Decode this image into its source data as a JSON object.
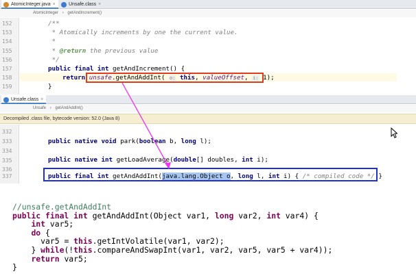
{
  "top_pane": {
    "tabs": [
      {
        "label": "AtomicInteger.java",
        "icon": "java-class-icon",
        "color": "#d08a2a"
      },
      {
        "label": "Unsafe.class",
        "icon": "class-file-icon",
        "color": "#3b7bd0"
      }
    ],
    "breadcrumb": [
      "AtomicInteger",
      "getAndIncrement()"
    ],
    "line_numbers": [
      "152",
      "153",
      "154",
      "155",
      "156",
      "157",
      "158",
      "159"
    ],
    "lines": {
      "l152": "/**",
      "l153": " * Atomically increments by one the current value.",
      "l154": " *",
      "l155_tag": "@return",
      "l155_rest": " the previous value",
      "l156": " */",
      "l157_kw": "public final int",
      "l157_rest": " getAndIncrement() {",
      "l158_kw": "return",
      "l158_field": "unsafe",
      "l158_mid": ".getAndAddInt(",
      "l158_hint1": "o:",
      "l158_this": "this",
      "l158_comma": ", ",
      "l158_offset": "valueOffset",
      "l158_comma2": ", ",
      "l158_hint2": "i:",
      "l158_end": " 1);",
      "l159": "}"
    }
  },
  "bottom_pane": {
    "tabs": [
      {
        "label": "Unsafe.class",
        "icon": "class-file-icon",
        "color": "#3b7bd0"
      }
    ],
    "breadcrumb": [
      "Unsafe",
      "getAndAddInt()"
    ],
    "banner": "Decompiled .class file, bytecode version: 52.0 (Java 8)",
    "line_numbers": [
      "332",
      "333",
      "334",
      "335",
      "336",
      "337"
    ],
    "lines": {
      "l333_kw": "public native void",
      "l333_mid": " park(",
      "l333_kw2": "boolean",
      "l333_mid2": " b, ",
      "l333_kw3": "long",
      "l333_end": " l);",
      "l335_kw": "public native int",
      "l335_mid": " getLoadAverage(",
      "l335_kw2": "double",
      "l335_end": "[] doubles, ",
      "l335_kw3": "int",
      "l335_end2": " i);",
      "l337_kw": "public final int",
      "l337_mid": " getAndAddInt(",
      "l337_sel": "java.lang.Object o",
      "l337_mid2": ", ",
      "l337_kw2": "long",
      "l337_mid3": " l, ",
      "l337_kw3": "int",
      "l337_mid4": " i) { ",
      "l337_cm": "/* compiled code */",
      "l337_end": " }"
    }
  },
  "snippet": {
    "comment": "//unsafe.getAndAddInt",
    "l1_kw": "public final int",
    "l1_rest": " getAndAddInt(Object var1, ",
    "l1_kw2": "long",
    "l1_rest2": " var2, ",
    "l1_kw3": "int",
    "l1_rest3": " var4) {",
    "l2_kw": "int",
    "l2_rest": " var5;",
    "l3_kw": "do",
    "l3_rest": " {",
    "l4_pre": "var5 = ",
    "l4_kw": "this",
    "l4_rest": ".getIntVolatile(var1, var2);",
    "l5_pre": "} ",
    "l5_kw": "while",
    "l5_mid": "(!",
    "l5_kw2": "this",
    "l5_rest": ".compareAndSwapInt(var1, var2, var5, var5 + var4));",
    "l6_kw": "return",
    "l6_rest": " var5;",
    "l7": "}"
  },
  "colors": {
    "red_box": "#e03a1f",
    "blue_box": "#1f2fd6",
    "arrow": "#ee33ee",
    "selection": "#a6c5f0"
  }
}
